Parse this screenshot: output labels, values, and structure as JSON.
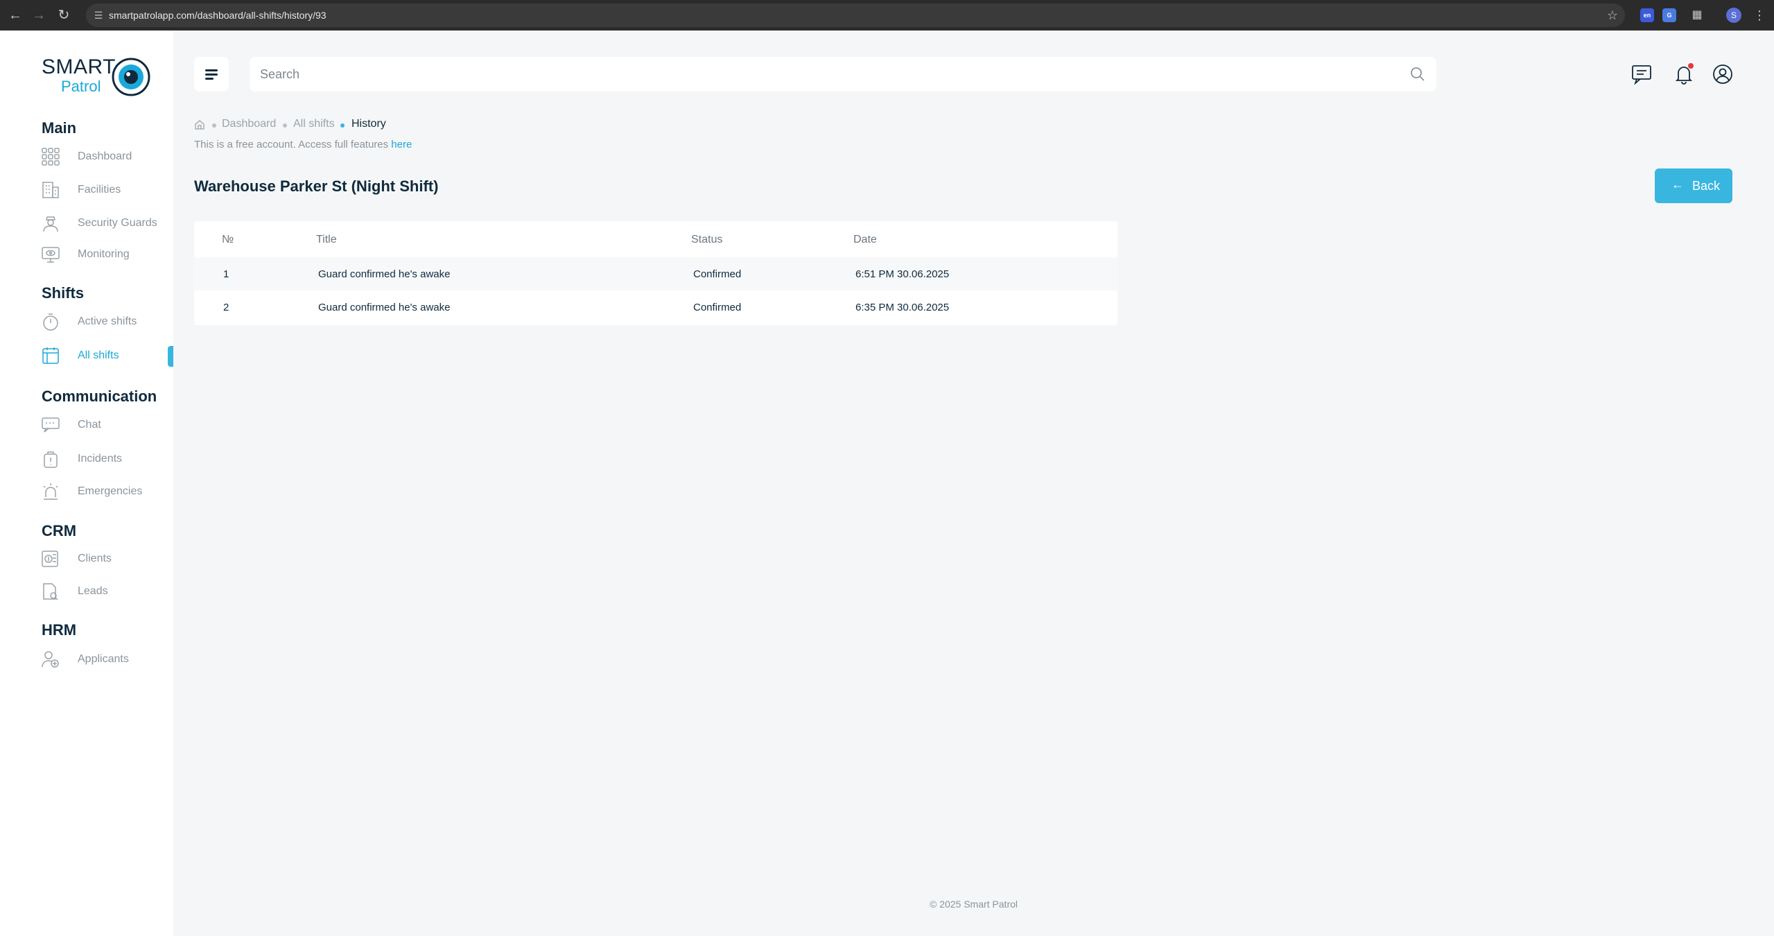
{
  "browser": {
    "url": "smartpatrolapp.com/dashboard/all-shifts/history/93",
    "extension_label": "en",
    "profile_initial": "S"
  },
  "logo": {
    "line1": "SMART",
    "line2": "Patrol"
  },
  "sidebar": {
    "sections": [
      {
        "title": "Main",
        "items": [
          {
            "label": "Dashboard",
            "icon": "grid-icon"
          },
          {
            "label": "Facilities",
            "icon": "building-icon"
          },
          {
            "label": "Security Guards",
            "icon": "guard-icon"
          },
          {
            "label": "Monitoring",
            "icon": "monitor-eye-icon"
          }
        ]
      },
      {
        "title": "Shifts",
        "items": [
          {
            "label": "Active shifts",
            "icon": "timer-icon"
          },
          {
            "label": "All shifts",
            "icon": "calendar-icon",
            "active": true
          }
        ]
      },
      {
        "title": "Communication",
        "items": [
          {
            "label": "Chat",
            "icon": "chat-icon"
          },
          {
            "label": "Incidents",
            "icon": "incident-icon"
          },
          {
            "label": "Emergencies",
            "icon": "siren-icon"
          }
        ]
      },
      {
        "title": "CRM",
        "items": [
          {
            "label": "Clients",
            "icon": "clients-icon"
          },
          {
            "label": "Leads",
            "icon": "leads-icon"
          }
        ]
      },
      {
        "title": "HRM",
        "items": [
          {
            "label": "Applicants",
            "icon": "applicant-icon"
          }
        ]
      }
    ]
  },
  "header": {
    "search_placeholder": "Search"
  },
  "breadcrumb": {
    "items": [
      "Dashboard",
      "All shifts"
    ],
    "current": "History"
  },
  "notice": {
    "text": "This is a free account. Access full features ",
    "link": "here"
  },
  "page": {
    "title": "Warehouse Parker St (Night Shift)",
    "back_label": "Back"
  },
  "table": {
    "columns": [
      "№",
      "Title",
      "Status",
      "Date"
    ],
    "rows": [
      {
        "num": "1",
        "title": "Guard confirmed he's awake",
        "status": "Confirmed",
        "date": "6:51 PM 30.06.2025"
      },
      {
        "num": "2",
        "title": "Guard confirmed he's awake",
        "status": "Confirmed",
        "date": "6:35 PM 30.06.2025"
      }
    ]
  },
  "footer": {
    "text": "© 2025 Smart Patrol"
  },
  "colors": {
    "accent": "#38b6e0",
    "text": "#0f2a3d",
    "muted": "#8a949c"
  }
}
